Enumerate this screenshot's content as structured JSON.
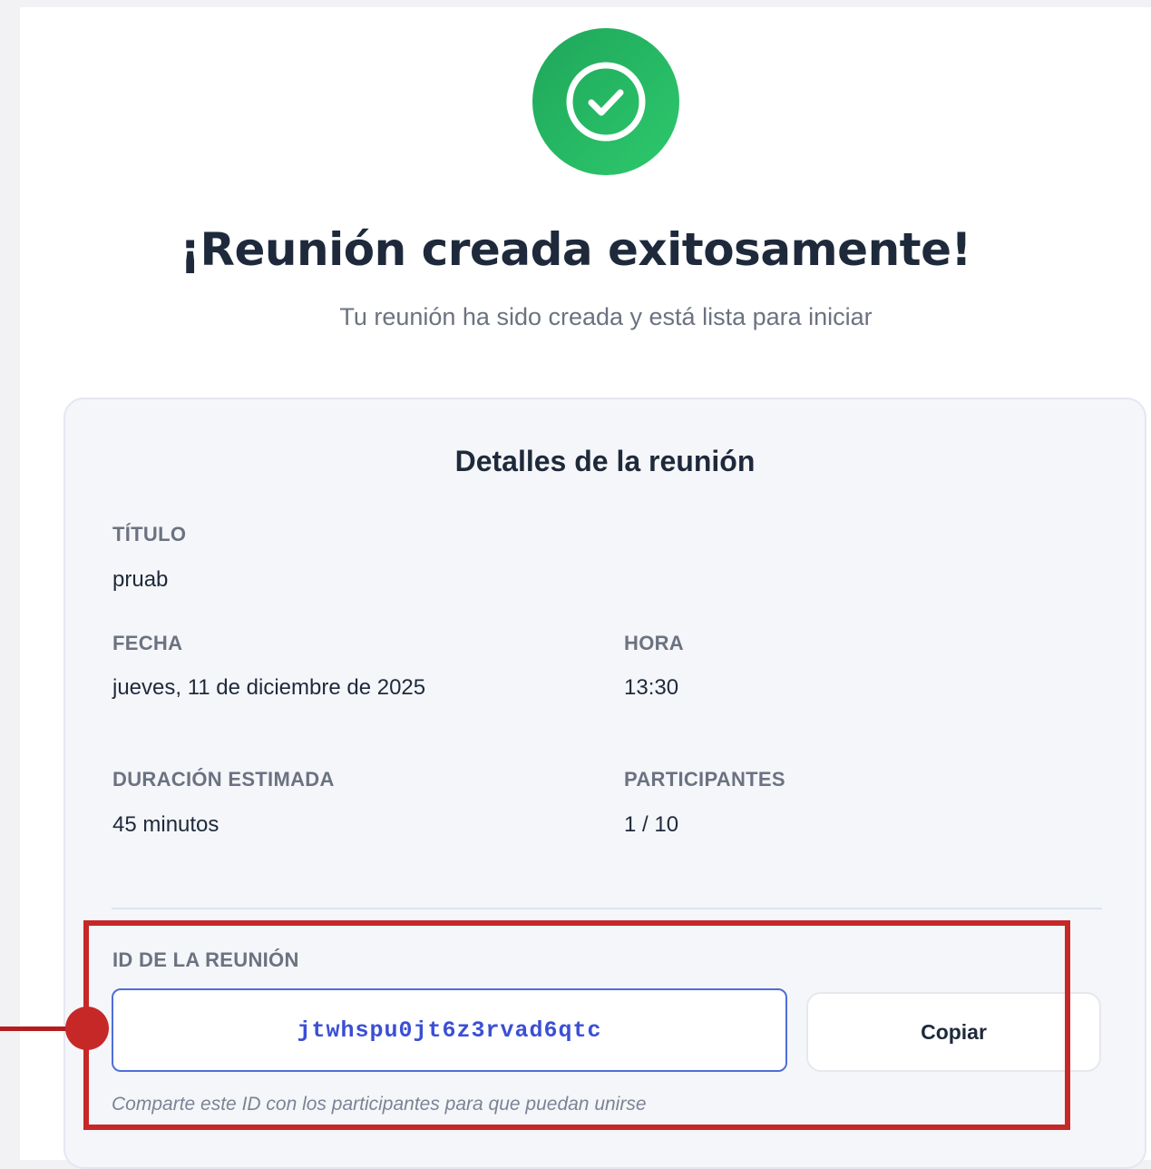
{
  "header": {
    "icon": "check-circle-icon",
    "title": "¡Reunión creada exitosamente!",
    "subtitle": "Tu reunión ha sido creada y está lista para iniciar"
  },
  "details": {
    "title": "Detalles de la reunión",
    "fields": {
      "titulo": {
        "label": "TÍTULO",
        "value": "pruab"
      },
      "fecha": {
        "label": "FECHA",
        "value": "jueves, 11 de diciembre de 2025"
      },
      "hora": {
        "label": "HORA",
        "value": "13:30"
      },
      "duracion": {
        "label": "DURACIÓN ESTIMADA",
        "value": "45 minutos"
      },
      "participantes": {
        "label": "PARTICIPANTES",
        "value": "1 / 10"
      }
    },
    "meeting_id": {
      "label": "ID DE LA REUNIÓN",
      "value": "jtwhspu0jt6z3rvad6qtc",
      "copy_label": "Copiar",
      "hint": "Comparte este ID con los participantes para que puedan unirse"
    }
  },
  "colors": {
    "success": "#22b862",
    "accent_id": "#3a4fd6",
    "highlight": "#c62828"
  }
}
